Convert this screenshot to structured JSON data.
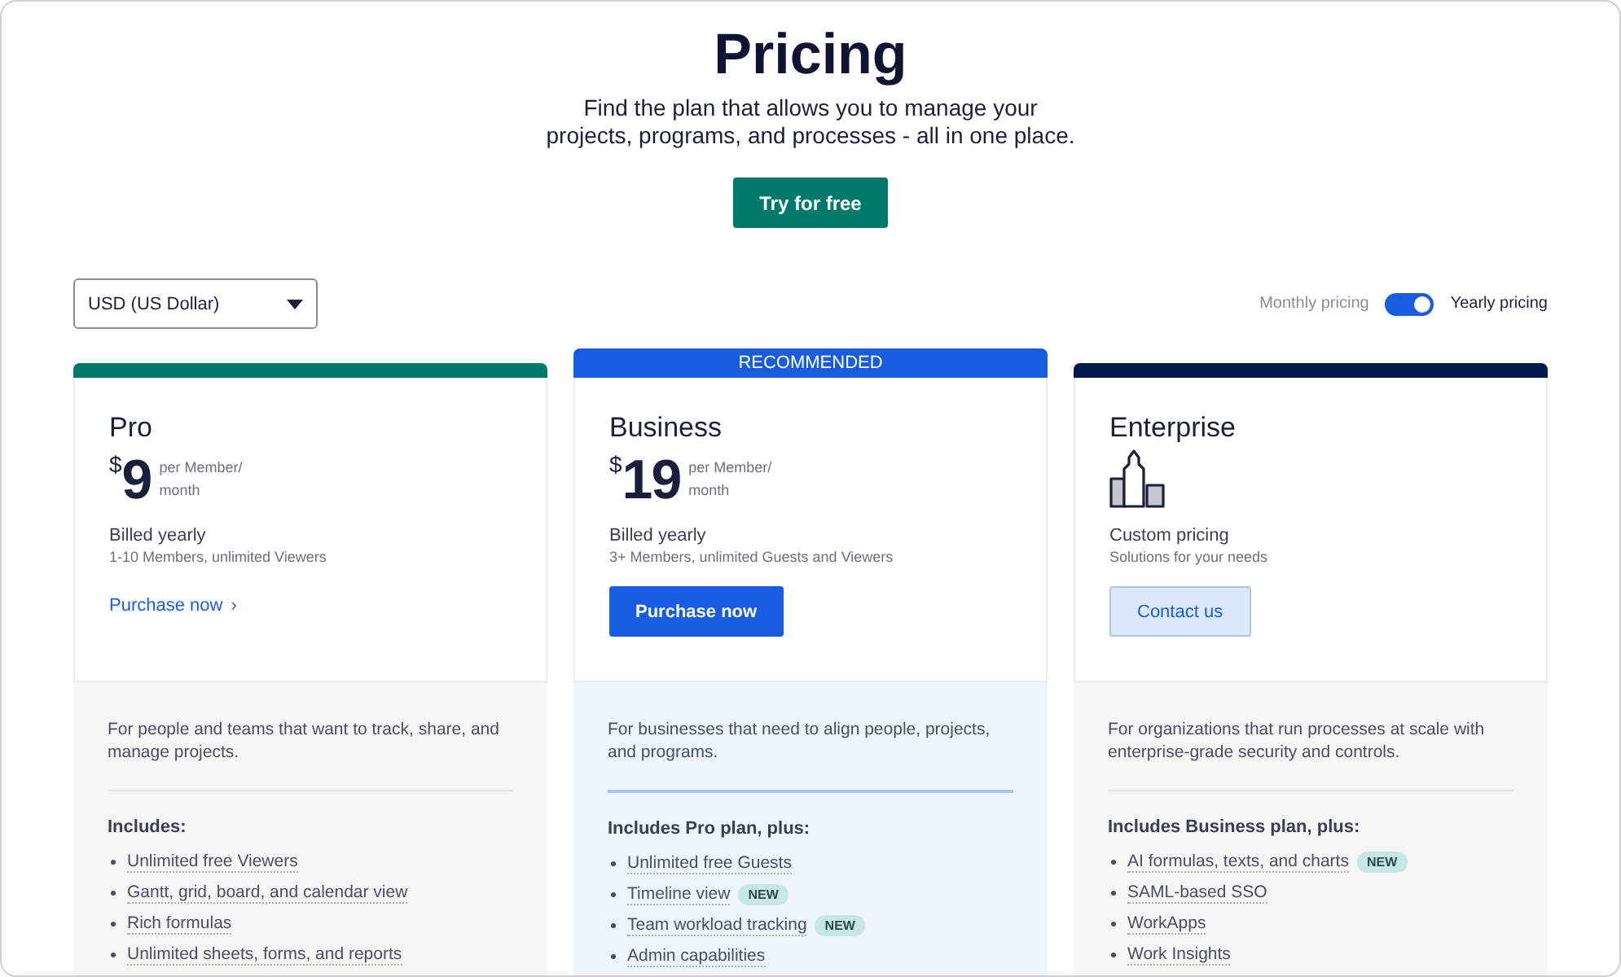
{
  "header": {
    "title": "Pricing",
    "subtitle_lines": [
      "Find the plan that allows you to manage your",
      "projects, programs, and processes - all in one place."
    ],
    "cta": "Try for free"
  },
  "currency": {
    "value": "USD (US Dollar)"
  },
  "billing_toggle": {
    "left_label": "Monthly pricing",
    "right_label": "Yearly pricing",
    "on": true
  },
  "plans": [
    {
      "name": "Pro",
      "color": "#00796b",
      "kind": "price",
      "currency_symbol": "$",
      "price": "9",
      "unit_lines": [
        "per Member/",
        "month"
      ],
      "billing": "Billed yearly",
      "seats": "1-10 Members, unlimited Viewers",
      "action": {
        "kind": "link",
        "label": "Purchase now",
        "icon": "›"
      },
      "description": "For people and teams that want to track, share, and manage projects.",
      "includes_heading": "Includes:",
      "features": [
        {
          "text": "Unlimited free Viewers"
        },
        {
          "text": "Gantt, grid, board, and calendar view"
        },
        {
          "text": "Rich formulas"
        },
        {
          "text": "Unlimited sheets, forms, and reports"
        }
      ]
    },
    {
      "name": "Business",
      "color": "#1a5ce0",
      "badge": "RECOMMENDED",
      "kind": "price",
      "currency_symbol": "$",
      "price": "19",
      "unit_lines": [
        "per Member/",
        "month"
      ],
      "billing": "Billed yearly",
      "seats": "3+ Members, unlimited Guests and Viewers",
      "action": {
        "kind": "primary",
        "label": "Purchase now"
      },
      "description": "For businesses that need to align people, projects, and programs.",
      "includes_heading": "Includes Pro plan, plus:",
      "features": [
        {
          "text": "Unlimited free Guests"
        },
        {
          "text": "Timeline view",
          "tag": "NEW"
        },
        {
          "text": "Team workload tracking",
          "tag": "NEW"
        },
        {
          "text": "Admin capabilities"
        }
      ]
    },
    {
      "name": "Enterprise",
      "color": "#001a4d",
      "kind": "custom",
      "billing": "Custom pricing",
      "seats": "Solutions for your needs",
      "action": {
        "kind": "secondary",
        "label": "Contact us"
      },
      "description": "For organizations that run processes at scale with enterprise-grade security and controls.",
      "includes_heading": "Includes Business plan, plus:",
      "features": [
        {
          "text": "AI formulas, texts, and charts",
          "tag": "NEW"
        },
        {
          "text": "SAML-based SSO"
        },
        {
          "text": "WorkApps"
        },
        {
          "text": "Work Insights"
        }
      ]
    }
  ]
}
